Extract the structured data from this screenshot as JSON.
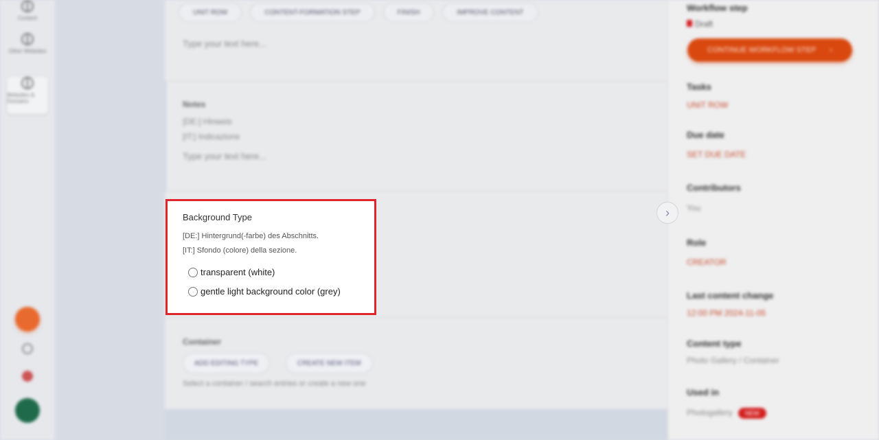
{
  "left_rail": {
    "items": [
      {
        "label": "Content"
      },
      {
        "label": "Other Websites"
      },
      {
        "label": "Websites & Domains"
      }
    ]
  },
  "main": {
    "chips": [
      "UNIT ROW",
      "CONTENT-FORMATION STEP",
      "FINISH",
      "IMPROVE CONTENT"
    ],
    "placeholder_top": "Type your text here...",
    "notes": {
      "label": "Notes",
      "de": "[DE:] Hinweis",
      "it": "[IT:] Indicazione",
      "placeholder": "Type your text here..."
    },
    "container": {
      "label": "Container",
      "chips": [
        "ADD EDITING TYPE",
        "CREATE NEW ITEM"
      ],
      "hint": "Select a container / search entries or create a new one"
    }
  },
  "focus": {
    "title": "Background Type",
    "desc_de": "[DE:] Hintergrund(-farbe) des Abschnitts.",
    "desc_it": "[IT:] Sfondo (colore) della sezione.",
    "options": [
      {
        "label": "transparent (white)"
      },
      {
        "label": "gentle light background color (grey)"
      }
    ]
  },
  "right_panel": {
    "workflow_label": "Workflow step",
    "workflow_value": "Draft",
    "primary_button": "CONTINUE WORKFLOW STEP",
    "tasks_label": "Tasks",
    "tasks_value": "UNIT ROW",
    "due_label": "Due date",
    "due_value": "SET DUE DATE",
    "contributors_label": "Contributors",
    "contributors_value": "You",
    "role_label": "Role",
    "role_value": "CREATOR",
    "last_change_label": "Last content change",
    "last_change_value": "12:00 PM 2024-11-05",
    "content_type_label": "Content type",
    "content_type_value": "Photo Gallery / Container",
    "used_in_label": "Used in",
    "used_in_value": "Photogallery",
    "used_in_badge": "NEW"
  },
  "colors": {
    "accent": "#d9480f",
    "focus_border": "#e0242e",
    "link": "#c64a2a"
  }
}
